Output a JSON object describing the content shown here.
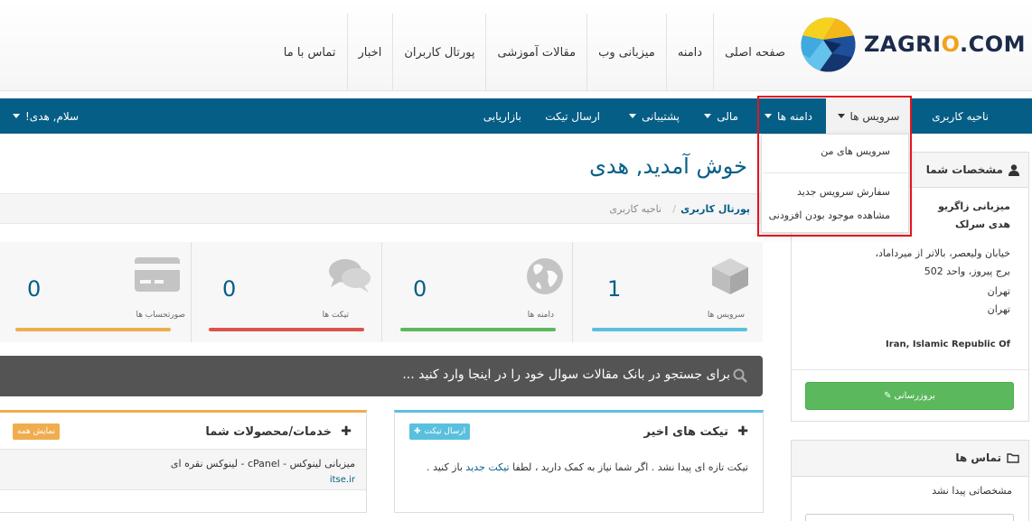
{
  "logo": {
    "text_main": "ZAGRI",
    "text_o": "O",
    "text_tail": ".COM"
  },
  "top_nav": [
    "صفحه اصلی",
    "دامنه",
    "میزبانی وب",
    "مقالات آموزشی",
    "پورتال کاربران",
    "اخبار",
    "تماس با ما"
  ],
  "main_nav": {
    "client_area": "ناحیه کاربری",
    "services": "سرویس ها",
    "domains": "دامنه ها",
    "billing": "مالی",
    "support": "پشتیبانی",
    "open_ticket": "ارسال تیکت",
    "affiliates": "بازاریابی",
    "hello_user": "سلام, هدی!"
  },
  "services_dropdown": {
    "my_services": "سرویس های من",
    "order_new": "سفارش سرویس جدید",
    "addons": "مشاهده موجود بودن افزودنی"
  },
  "page": {
    "title": "خوش آمدید, هدی",
    "breadcrumb": [
      "پورتال کاربری",
      "ناحیه کاربری"
    ]
  },
  "stats": [
    {
      "label": "سرویس ها",
      "value": "1",
      "icon": "cube-icon",
      "color": "#5bc0de"
    },
    {
      "label": "دامنه ها",
      "value": "0",
      "icon": "globe-icon",
      "color": "#5cb85c"
    },
    {
      "label": "تیکت ها",
      "value": "0",
      "icon": "comments-icon",
      "color": "#d9534f"
    },
    {
      "label": "صورتحساب ها",
      "value": "0",
      "icon": "credit-card-icon",
      "color": "#f0ad4e"
    }
  ],
  "search": {
    "placeholder": "برای جستجو در بانک مقالات سوال خود را در اینجا وارد کنید ..."
  },
  "tickets_panel": {
    "title": "تیکت های اخیر",
    "button": "ارسال تیکت",
    "message_start": "تیکت تازه ای پیدا نشد . اگر شما نیاز به کمک دارید ، لطفا",
    "message_link": "تیکت جدید",
    "message_end": "باز کنید .",
    "accent": "#5bc0de"
  },
  "products_panel": {
    "title": "خدمات/محصولات شما",
    "button": "نمایش همه",
    "item_name": "میزبانی لینوکس - cPanel - لینوکس نقره ای",
    "item_domain": "itse.ir",
    "accent": "#f0ad4e"
  },
  "profile_panel": {
    "title": "مشخصات شما",
    "company": "میزبانی زاگریو",
    "name": "هدی سرلک",
    "address1": "خیابان ولیعصر، بالاتر از میرداماد،",
    "address2": "برج پیروز، واحد 502",
    "city": "تهران",
    "state": "تهران",
    "country": "Iran, Islamic Republic Of",
    "update_button": "بروزرسانی"
  },
  "contacts_panel": {
    "title": "تماس ها",
    "empty": "مشخصاتی پیدا نشد"
  },
  "colors": {
    "nav_blue": "#055e86",
    "highlight_red": "#e3151d",
    "green": "#5cb85c"
  }
}
